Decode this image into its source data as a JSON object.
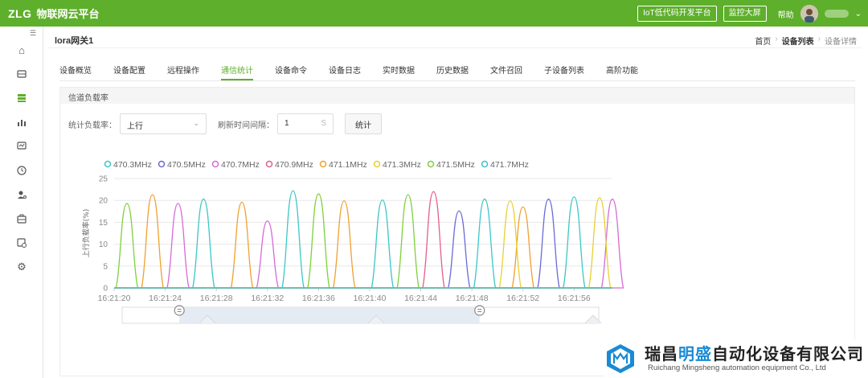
{
  "topbar": {
    "logo": "ZLG",
    "title": "物联网云平台",
    "btn_lowcode": "IoT低代码开发平台",
    "btn_screen": "监控大屏",
    "help": "帮助"
  },
  "page": {
    "title": "lora网关1",
    "breadcrumb": [
      "首页",
      "设备列表",
      "设备详情"
    ]
  },
  "tabs": [
    "设备概览",
    "设备配置",
    "远程操作",
    "通信统计",
    "设备命令",
    "设备日志",
    "实时数据",
    "历史数据",
    "文件召回",
    "子设备列表",
    "高阶功能"
  ],
  "active_tab": 3,
  "panel": {
    "header": "信道负载率",
    "label_load": "统计负载率：",
    "select_value": "上行",
    "label_refresh": "刷新时间间隔：",
    "refresh_value": "1",
    "refresh_unit": "S",
    "btn_stat": "统计"
  },
  "colors": {
    "brand": "#5eaf2b",
    "series": [
      "#3cc6c6",
      "#6a6ad6",
      "#d66ad6",
      "#e0608a",
      "#f0a030",
      "#e8d030",
      "#7ed03c",
      "#3cc0d0"
    ]
  },
  "chart_data": {
    "type": "line",
    "legend": [
      "470.3MHz",
      "470.5MHz",
      "470.7MHz",
      "470.9MHz",
      "471.1MHz",
      "471.3MHz",
      "471.5MHz",
      "471.7MHz"
    ],
    "ylabel": "上行负载率(%)",
    "ylim": [
      0,
      25
    ],
    "yticks": [
      0,
      5,
      10,
      15,
      20,
      25
    ],
    "xticks": [
      "16:21:20",
      "16:21:24",
      "16:21:28",
      "16:21:32",
      "16:21:36",
      "16:21:40",
      "16:21:44",
      "16:21:48",
      "16:21:52",
      "16:21:56"
    ],
    "xlim": [
      0,
      39
    ],
    "peaks": [
      {
        "t": 1,
        "v": 19.3,
        "s": 6
      },
      {
        "t": 3,
        "v": 21.3,
        "s": 4
      },
      {
        "t": 5,
        "v": 19.3,
        "s": 2
      },
      {
        "t": 7,
        "v": 20.3,
        "s": 0
      },
      {
        "t": 10,
        "v": 19.6,
        "s": 4
      },
      {
        "t": 12,
        "v": 15.3,
        "s": 2
      },
      {
        "t": 14,
        "v": 22.2,
        "s": 0
      },
      {
        "t": 16,
        "v": 21.5,
        "s": 6
      },
      {
        "t": 18,
        "v": 19.9,
        "s": 4
      },
      {
        "t": 21,
        "v": 20.1,
        "s": 0
      },
      {
        "t": 23,
        "v": 21.3,
        "s": 6
      },
      {
        "t": 25,
        "v": 22.0,
        "s": 3
      },
      {
        "t": 27,
        "v": 17.6,
        "s": 1
      },
      {
        "t": 29,
        "v": 20.3,
        "s": 0
      },
      {
        "t": 31,
        "v": 19.9,
        "s": 5
      },
      {
        "t": 32,
        "v": 18.5,
        "s": 4
      },
      {
        "t": 34,
        "v": 20.3,
        "s": 1
      },
      {
        "t": 36,
        "v": 20.8,
        "s": 0
      },
      {
        "t": 38,
        "v": 20.6,
        "s": 5
      },
      {
        "t": 39,
        "v": 20.3,
        "s": 2
      }
    ],
    "grid": "horizontal",
    "legend_position": "top-left",
    "zoom_range": [
      0.12,
      0.75
    ]
  },
  "watermark": {
    "cn_pre": "瑞昌",
    "cn_blue": "明盛",
    "cn_post": "自动化设备有限公司",
    "en": "Ruichang Mingsheng automation equipment Co., Ltd"
  }
}
